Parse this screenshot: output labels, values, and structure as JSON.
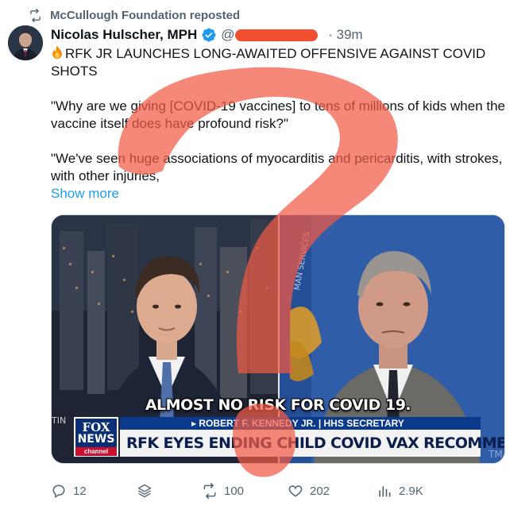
{
  "repost": {
    "label": "McCullough Foundation reposted",
    "icon": "repost-icon"
  },
  "author": {
    "name": "Nicolas Hulscher, MPH",
    "verified": true,
    "handle_prefix": "@",
    "time": "· 39m"
  },
  "post": {
    "headline_emoji": "fire-icon",
    "headline": "RFK JR LAUNCHES LONG-AWAITED OFFENSIVE AGAINST COVID SHOTS",
    "quote1": "\"Why are we giving [COVID-19 vaccines] to tens of millions of kids when the vaccine itself does have profound risk?\"",
    "quote2": "\"We've seen huge associations of myocarditis and pericarditis, with strokes, with other injuries,",
    "show_more": "Show more"
  },
  "media": {
    "overlay_caption": "ALMOST NO RISK FOR COVID 19.",
    "lower_third_name": "▸ ROBERT F. KENNEDY JR. | HHS SECRETARY",
    "lower_third_headline": "RFK EYES ENDING CHILD COVID VAX RECOMMENDATION",
    "logo_fox": "FOX",
    "logo_news": "NEWS",
    "logo_channel": "channel",
    "wall_text": "MAN SERVICES",
    "left_edge_text": "TIN",
    "right_edge_text": "TM"
  },
  "actions": {
    "replies": "12",
    "reposts": "100",
    "likes": "202",
    "views": "2.9K"
  },
  "colors": {
    "accent": "#1d9bf0",
    "muted": "#536471",
    "overlay_red": "#f15a45",
    "fox_blue": "#0a2f76"
  }
}
